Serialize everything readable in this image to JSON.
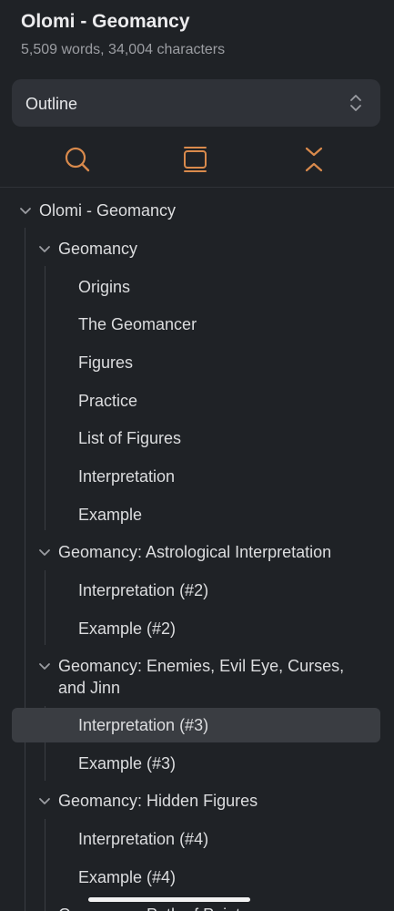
{
  "header": {
    "title": "Olomi - Geomancy",
    "stats": "5,509 words, 34,004 characters"
  },
  "view_select": {
    "value": "Outline"
  },
  "toolbar": {
    "icons": [
      "search-icon",
      "panel-icon",
      "collapse-all-icon"
    ],
    "accent_color": "#d98a4c"
  },
  "outline": {
    "root": "Olomi - Geomancy",
    "s1": {
      "title": "Geomancy",
      "items": [
        "Origins",
        "The Geomancer",
        "Figures",
        "Practice",
        "List of Figures",
        "Interpretation",
        "Example"
      ]
    },
    "s2": {
      "title": "Geomancy: Astrological Interpretation",
      "items": [
        "Interpretation (#2)",
        "Example (#2)"
      ]
    },
    "s3": {
      "title": "Geomancy: Enemies, Evil Eye, Curses, and Jinn",
      "items": [
        "Interpretation (#3)",
        "Example (#3)"
      ]
    },
    "s4": {
      "title": "Geomancy: Hidden Figures",
      "items": [
        "Interpretation (#4)",
        "Example (#4)"
      ]
    },
    "s5": {
      "title": "Geomancy: Path of Points"
    },
    "selected_item": "Interpretation (#3)"
  }
}
